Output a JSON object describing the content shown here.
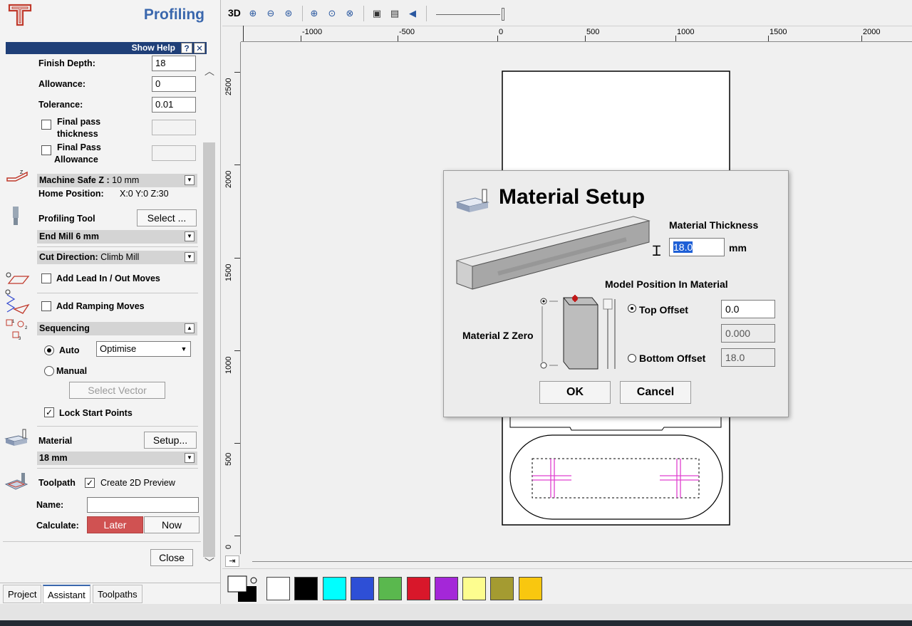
{
  "panel": {
    "title": "Profiling",
    "show_help": "Show Help",
    "help_q": "?",
    "help_x": "✕",
    "finish_depth_label": "Finish Depth:",
    "finish_depth_value": "18",
    "allowance_label": "Allowance:",
    "allowance_value": "0",
    "tolerance_label": "Tolerance:",
    "tolerance_value": "0.01",
    "final_pass_thickness_l1": "Final pass",
    "final_pass_thickness_l2": "thickness",
    "final_pass_allowance_l1": "Final Pass",
    "final_pass_allowance_l2": "Allowance",
    "machine_safe_z_label": "Machine Safe Z :",
    "machine_safe_z_value": "10 mm",
    "home_position_label": "Home Position:",
    "home_position_value": "X:0 Y:0 Z:30",
    "profiling_tool_label": "Profiling Tool",
    "select_button": "Select ...",
    "tool_name": "End Mill 6 mm",
    "cut_direction_label": "Cut Direction:",
    "cut_direction_value": "Climb Mill",
    "lead_in_out": "Add Lead In / Out Moves",
    "ramping": "Add Ramping Moves",
    "sequencing": "Sequencing",
    "auto": "Auto",
    "auto_option": "Optimise",
    "manual": "Manual",
    "select_vector": "Select Vector",
    "lock_start_points": "Lock Start Points",
    "material_label": "Material",
    "setup_button": "Setup...",
    "material_value": "18 mm",
    "toolpath_label": "Toolpath",
    "create_2d_preview": "Create 2D Preview",
    "name_label": "Name:",
    "name_value": "",
    "calculate_label": "Calculate:",
    "later_button": "Later",
    "now_button": "Now",
    "close_button": "Close",
    "tabs": [
      "Project",
      "Assistant",
      "Toolpaths"
    ]
  },
  "toolbar": {
    "three_d": "3D"
  },
  "rulers": {
    "h_labels": [
      "-1000",
      "-500",
      "0",
      "500",
      "1000",
      "1500",
      "2000"
    ],
    "v_labels": [
      "2500",
      "2000",
      "1500",
      "1000",
      "500",
      "0"
    ]
  },
  "palette": {
    "colors": [
      "#ffffff",
      "#000000",
      "#00ffff",
      "#2e4fd6",
      "#5ab84e",
      "#d8172a",
      "#a427d8",
      "#fdfd8f",
      "#a49b31",
      "#f9c70f"
    ]
  },
  "dialog": {
    "title": "Material Setup",
    "thickness_label": "Material Thickness",
    "thickness_value": "18.0",
    "thickness_unit": "mm",
    "model_position_label": "Model Position In Material",
    "z_zero_label": "Material Z Zero",
    "top_offset_label": "Top Offset",
    "top_offset_value": "0.0",
    "mid_value": "0.000",
    "bottom_offset_label": "Bottom Offset",
    "bottom_offset_value": "18.0",
    "ok": "OK",
    "cancel": "Cancel"
  }
}
